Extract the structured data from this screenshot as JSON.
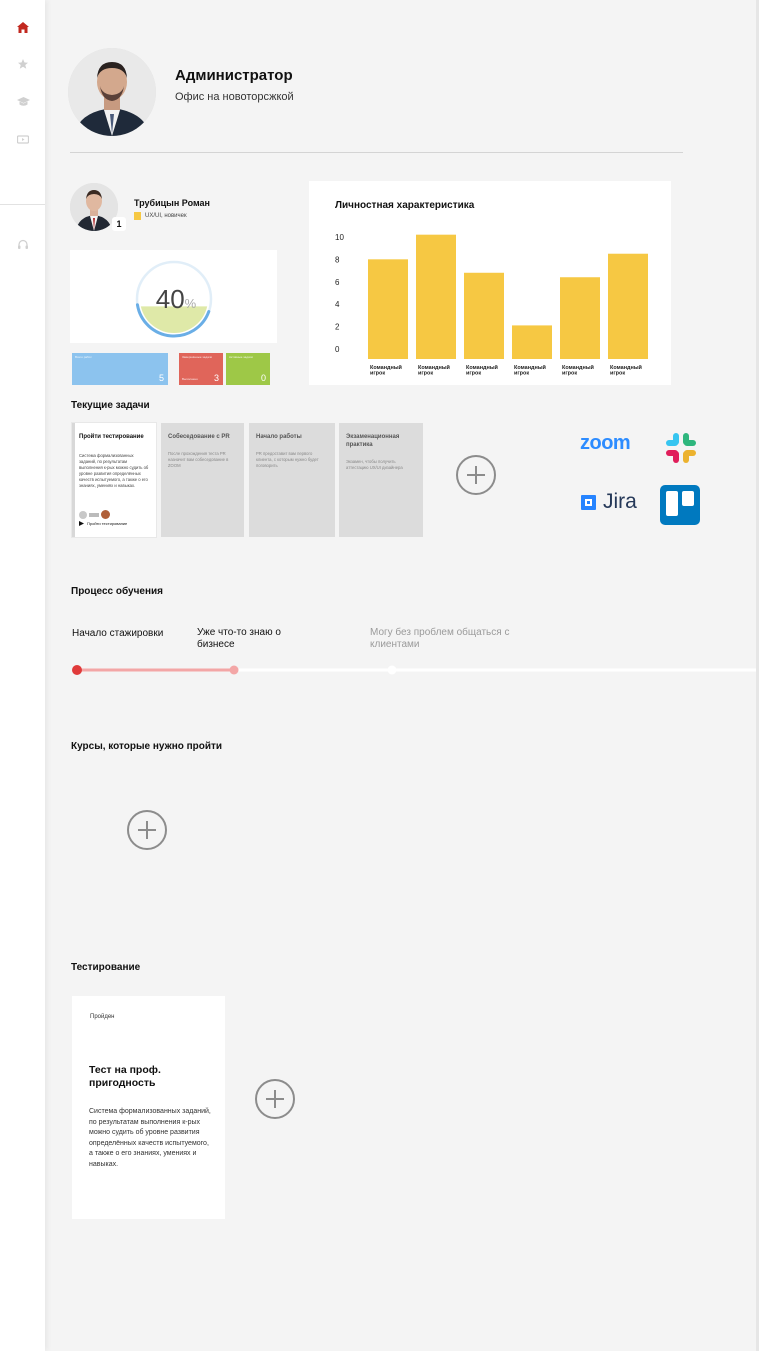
{
  "sidebar": {
    "items": [
      {
        "icon": "home-icon",
        "active": true
      },
      {
        "icon": "star-icon",
        "active": false
      },
      {
        "icon": "graduation-cap-icon",
        "active": false
      },
      {
        "icon": "video-icon",
        "active": false
      },
      {
        "icon": "headset-icon",
        "active": false
      }
    ]
  },
  "header": {
    "name": "Администратор",
    "office": "Офис на новоторсжкой"
  },
  "user": {
    "name": "Трубицын Роман",
    "role": "UX/UI, новичек",
    "badge": "1"
  },
  "progress": {
    "value": 40,
    "value_text": "40",
    "unit": "%"
  },
  "stats": [
    {
      "label": "Всего работ",
      "label2": "",
      "value": "5",
      "color": "#8cc3ee"
    },
    {
      "label": "Завершённые задачи",
      "label2": "Выполнено",
      "value": "3",
      "color": "#e0655a"
    },
    {
      "label": "Активные задачи",
      "label2": "",
      "value": "0",
      "color": "#9ec847"
    }
  ],
  "chart_data": {
    "type": "bar",
    "title": "Личностная характеристика",
    "categories": [
      "Командный игрок",
      "Командный игрок",
      "Командный игрок",
      "Командный игрок",
      "Командный игрок",
      "Командный игрок"
    ],
    "tick_line1": "Командный",
    "tick_line2": "игрок",
    "values": [
      8.9,
      11.1,
      7.7,
      3.0,
      7.3,
      9.4
    ],
    "yticks": [
      0,
      2,
      4,
      6,
      8,
      10
    ],
    "ylim": [
      0,
      11.2
    ],
    "bar_color": "#f6c843",
    "grid": false
  },
  "tasks": {
    "title": "Текущие задачи",
    "items": [
      {
        "title": "Пройти тестирование",
        "desc": "Система формализованных заданий, по результатам выполнения к-рых можно судить об уровне развития определённых качеств испытуемого, а также о его знаниях, умениях и навыках.",
        "link": "Пройти тестирование",
        "active": true
      },
      {
        "title": "Собеседование с PR",
        "desc": "После прохождения теста PR назначит вам собеседование в ZOOM",
        "active": false
      },
      {
        "title": "Начало работы",
        "desc": "PR предоставит вам первого клиента, с которым нужно будет поговорить",
        "active": false
      },
      {
        "title": "Экзаменационная практика",
        "desc": "Экзамен, чтобы получить аттестацию UX/UI дизайнера",
        "active": false
      }
    ]
  },
  "integrations": {
    "zoom": "zoom",
    "jira": "Jira",
    "slack_icon": "slack-icon",
    "trello_icon": "trello-icon"
  },
  "learning": {
    "title": "Процесс обучения",
    "steps": [
      {
        "label": "Начало стажировки",
        "state": "current",
        "color": "#e03a3a"
      },
      {
        "label": "Уже что-то знаю о бизнесе",
        "state": "next",
        "color": "#f3a6a6"
      },
      {
        "label": "Могу без проблем общаться с клиентами",
        "state": "locked",
        "color": "#ffffff"
      }
    ]
  },
  "courses": {
    "title": "Курсы, которые нужно пройти"
  },
  "testing": {
    "title": "Тестирование",
    "card": {
      "status": "Пройден",
      "title": "Тест на проф. пригодность",
      "desc": "Система формализованных заданий, по результатам выполнения к-рых можно судить об уровне развития определённых качеств испытуемого, а также о его знаниях, умениях и навыках."
    }
  }
}
